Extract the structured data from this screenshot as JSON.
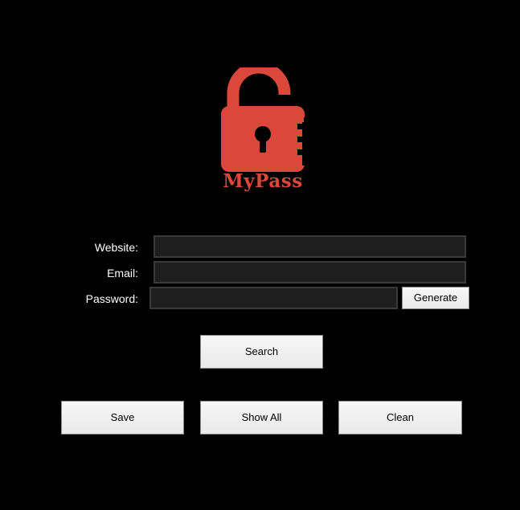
{
  "brand": {
    "name": "MyPass",
    "color": "#d9483b",
    "icon": "padlock-open-icon"
  },
  "form": {
    "website_label": "Website:",
    "website_value": "",
    "email_label": "Email:",
    "email_value": "",
    "password_label": "Password:",
    "password_value": ""
  },
  "buttons": {
    "generate": "Generate",
    "search": "Search",
    "save": "Save",
    "show_all": "Show All",
    "clean": "Clean"
  }
}
